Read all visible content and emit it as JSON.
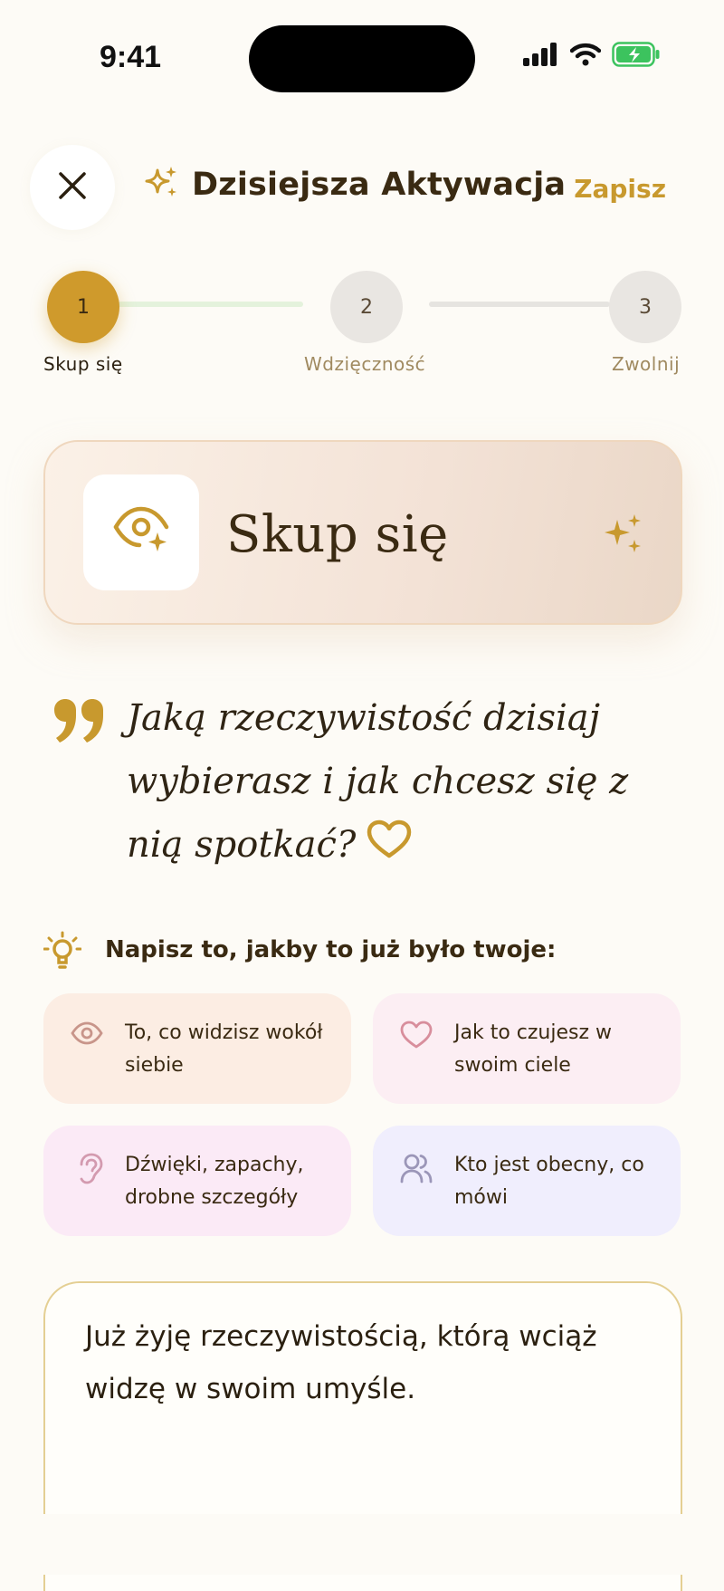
{
  "status_bar": {
    "time": "9:41",
    "icons": [
      "cellular-signal-icon",
      "wifi-icon",
      "battery-charging-icon"
    ]
  },
  "header": {
    "close_icon": "close-icon",
    "title_icon": "sparkles-icon",
    "title": "Dzisiejsza Aktywacja",
    "save_label": "Zapisz"
  },
  "stepper": {
    "steps": [
      {
        "number": "1",
        "label": "Skup się",
        "state": "active"
      },
      {
        "number": "2",
        "label": "Wdzięczność",
        "state": "upcoming"
      },
      {
        "number": "3",
        "label": "Zwolnij",
        "state": "upcoming"
      }
    ]
  },
  "focus_card": {
    "icon": "eye-sparkle-icon",
    "title": "Skup się",
    "decoration_icon": "sparkles-icon"
  },
  "question": {
    "quote_icon": "quote-icon",
    "text": "Jaką rzeczywistość dzisiaj wybierasz i jak chcesz się z nią spotkać?",
    "heart_icon": "heart-icon"
  },
  "hint": {
    "icon": "lightbulb-icon",
    "text": "Napisz to, jakby to już było twoje:"
  },
  "prompts": [
    {
      "icon": "eye-icon",
      "text": "To, co widzisz wokół siebie",
      "color": "#FCEDE3"
    },
    {
      "icon": "heart-icon",
      "text": "Jak to czujesz w swoim ciele",
      "color": "#FCEEF3"
    },
    {
      "icon": "ear-icon",
      "text": "Dźwięki, zapachy, drobne szczegóły",
      "color": "#FBEAF6"
    },
    {
      "icon": "people-icon",
      "text": "Kto jest obecny, co mówi",
      "color": "#F0EEFD"
    }
  ],
  "entry": {
    "value": "Już żyję rzeczywistością, którą wciąż widzę w swoim umyśle."
  },
  "colors": {
    "background": "#FDFBF6",
    "accent": "#CF9A2C",
    "text": "#3A2A12"
  }
}
